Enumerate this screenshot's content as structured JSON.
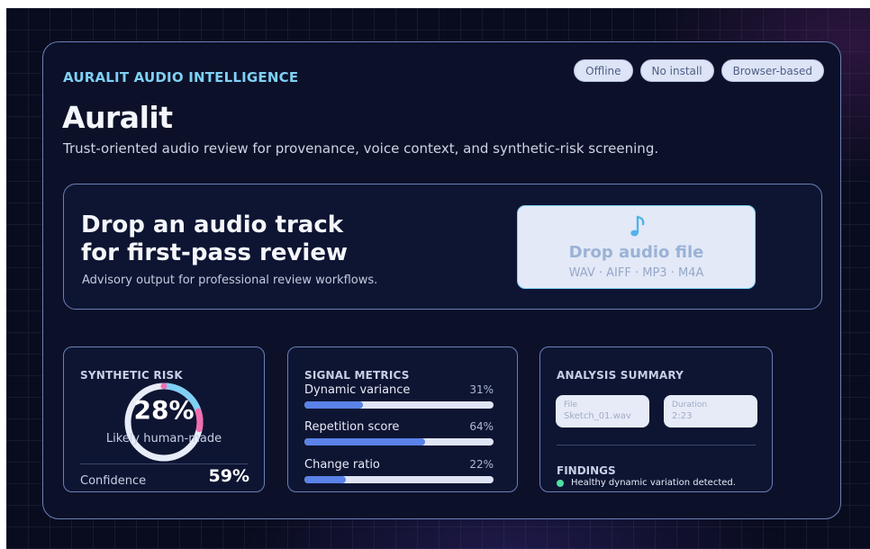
{
  "header": {
    "eyebrow": "AURALIT AUDIO INTELLIGENCE",
    "title": "Auralit",
    "subtitle": "Trust-oriented audio review for provenance, voice context, and synthetic-risk screening.",
    "badges": [
      "Offline",
      "No install",
      "Browser-based"
    ]
  },
  "upload": {
    "heading_line1": "Drop an audio track",
    "heading_line2": "for first-pass review",
    "description": "Advisory output for professional review workflows.",
    "drop_label": "Drop audio file",
    "formats": "WAV · AIFF · MP3 · M4A",
    "icon": "music-note-icon"
  },
  "synthetic_risk": {
    "title": "SYNTHETIC RISK",
    "value": "28%",
    "fraction": 0.28,
    "caption": "Likely human-made",
    "confidence_label": "Confidence",
    "confidence_value": "59%"
  },
  "signal_metrics": {
    "title": "SIGNAL METRICS",
    "items": [
      {
        "label": "Dynamic variance",
        "pct": "31%",
        "value": 0.31
      },
      {
        "label": "Repetition score",
        "pct": "64%",
        "value": 0.64
      },
      {
        "label": "Change ratio",
        "pct": "22%",
        "value": 0.22
      }
    ]
  },
  "analysis_summary": {
    "title": "ANALYSIS SUMMARY",
    "file_label": "File",
    "file_value": "Sketch_01.wav",
    "duration_label": "Duration",
    "duration_value": "2:23",
    "findings_title": "FINDINGS",
    "findings": [
      "Healthy dynamic variation detected."
    ]
  },
  "colors": {
    "accent": "#7fd0f5",
    "bar": "#5a82e8",
    "risk_high": "#f06fb0",
    "finding_ok": "#4fe0a2"
  }
}
